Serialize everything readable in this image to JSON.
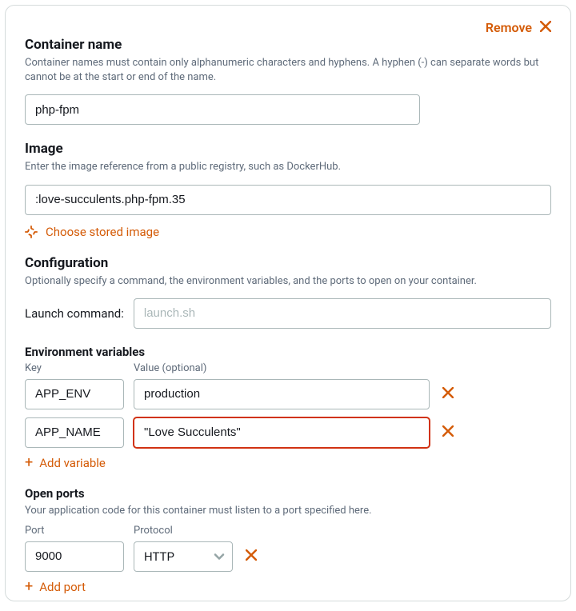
{
  "remove": {
    "label": "Remove"
  },
  "container_name": {
    "title": "Container name",
    "desc": "Container names must contain only alphanumeric characters and hyphens. A hyphen (-) can separate words but cannot be at the start or end of the name.",
    "value": "php-fpm"
  },
  "image": {
    "title": "Image",
    "desc": "Enter the image reference from a public registry, such as DockerHub.",
    "value": ":love-succulents.php-fpm.35",
    "choose_label": "Choose stored image"
  },
  "config": {
    "title": "Configuration",
    "desc": "Optionally specify a command, the environment variables, and the ports to open on your container.",
    "launch_label": "Launch command:",
    "launch_placeholder": "launch.sh",
    "launch_value": ""
  },
  "env": {
    "title": "Environment variables",
    "key_header": "Key",
    "value_header": "Value (optional)",
    "rows": [
      {
        "key": "APP_ENV",
        "value": "production"
      },
      {
        "key": "APP_NAME",
        "value": "\"Love Succulents\""
      }
    ],
    "add_label": "Add variable"
  },
  "ports": {
    "title": "Open ports",
    "desc": "Your application code for this container must listen to a port specified here.",
    "port_header": "Port",
    "protocol_header": "Protocol",
    "rows": [
      {
        "port": "9000",
        "protocol": "HTTP"
      }
    ],
    "add_label": "Add port"
  }
}
